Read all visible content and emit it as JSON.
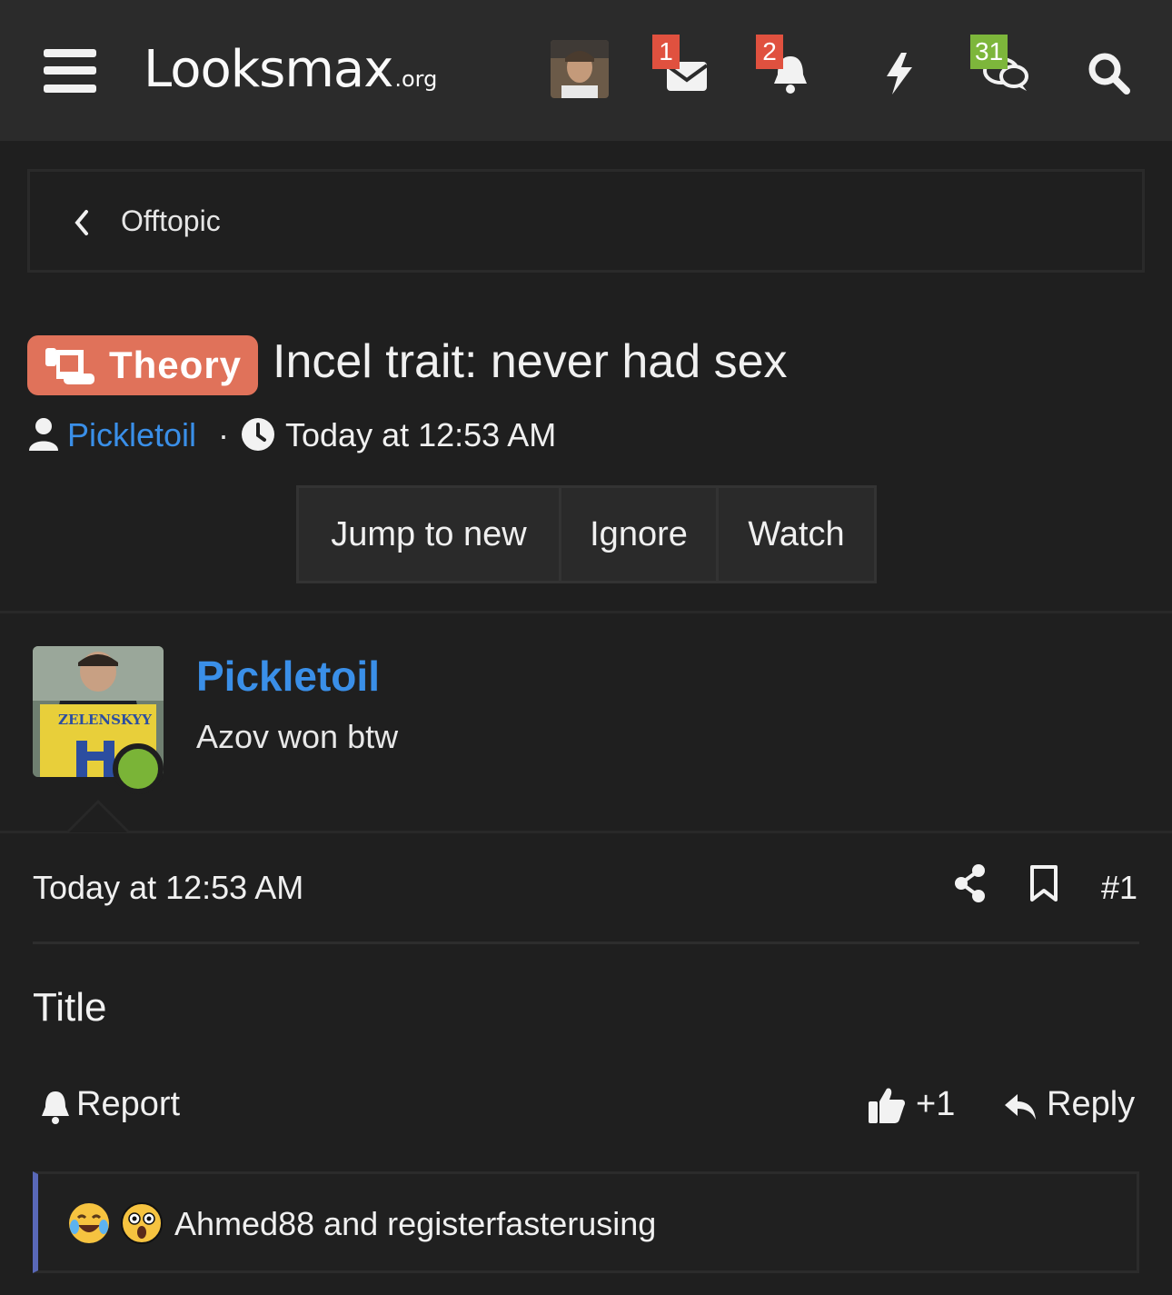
{
  "header": {
    "logo_main": "Looksmax",
    "logo_suffix": ".org",
    "conversations_badge": "1",
    "alerts_badge": "2",
    "whats_new_badge": "31",
    "icons": [
      "menu-icon",
      "envelope-icon",
      "bell-icon",
      "bolt-icon",
      "chat-bubbles-icon",
      "search-icon"
    ]
  },
  "breadcrumb": {
    "label": "Offtopic"
  },
  "thread": {
    "prefix": "Theory",
    "title": "Incel trait: never had sex",
    "author": "Pickletoil",
    "separator": "·",
    "date": "Today at 12:53 AM",
    "prefix_color": "#e0725a"
  },
  "thread_buttons": {
    "jump": "Jump to new",
    "ignore": "Ignore",
    "watch": "Watch"
  },
  "post": {
    "username": "Pickletoil",
    "user_title": "Azov won btw",
    "avatar_caption": "ZELENSKYY",
    "date": "Today at 12:53 AM",
    "number": "#1",
    "body": "Title",
    "report_label": "Report",
    "like_count": "+1",
    "reply_label": "Reply",
    "reactions_text": "Ahmed88 and registerfasterusing"
  },
  "colors": {
    "link": "#3a8fe8",
    "online": "#7ab437",
    "badge_red": "#e0513f",
    "badge_green": "#7db63b",
    "reaction_bar": "#5968b8"
  }
}
